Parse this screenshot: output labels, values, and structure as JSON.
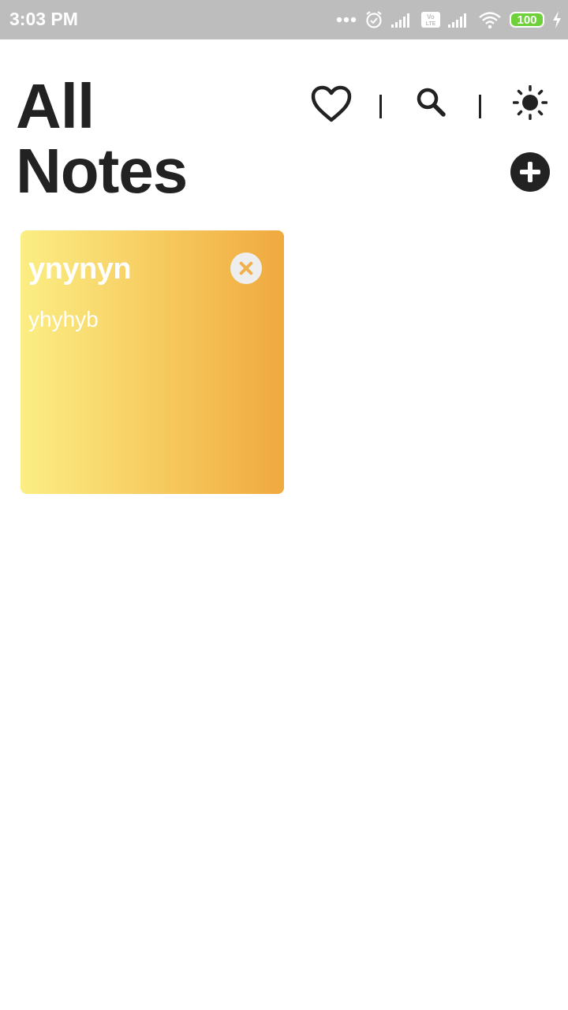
{
  "status_bar": {
    "time": "3:03 PM",
    "battery_level": "100",
    "icons": [
      "more-dots-icon",
      "alarm-icon",
      "signal-icon",
      "volte-icon",
      "signal-icon",
      "wifi-icon",
      "battery-icon",
      "charging-icon"
    ]
  },
  "header": {
    "title_line1": "All",
    "title_line2": "Notes"
  },
  "toolbar": {
    "icons": [
      "heart-icon",
      "search-icon",
      "brightness-icon",
      "add-icon"
    ]
  },
  "notes": [
    {
      "title": "ynynyn",
      "body": "yhyhyb",
      "gradient": [
        "#fbee84",
        "#efa93f"
      ]
    }
  ],
  "colors": {
    "text": "#222222",
    "status_bar": "#bdbdbd",
    "delete_accent": "#f1b04d"
  }
}
